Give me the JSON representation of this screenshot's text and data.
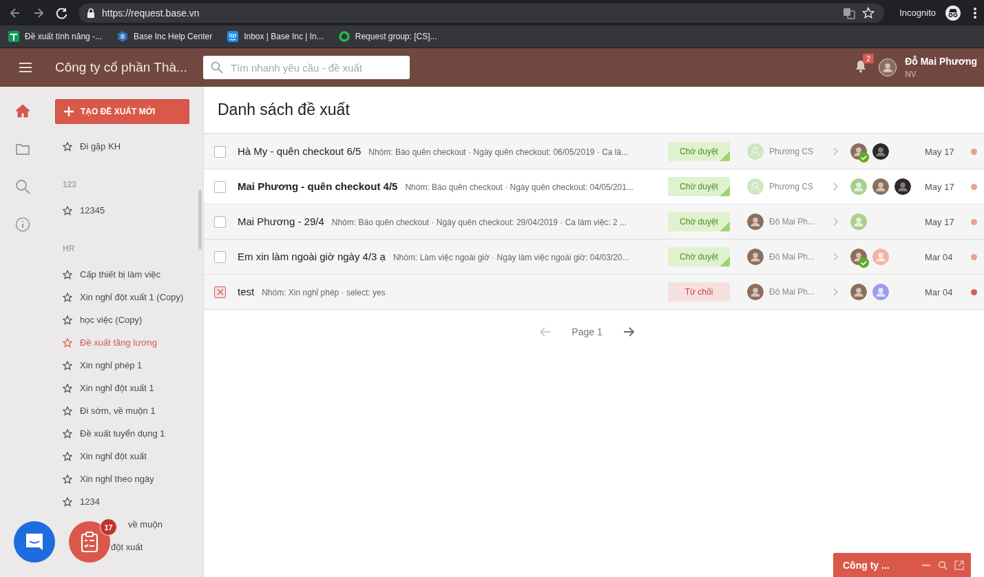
{
  "browser": {
    "url": "https://request.base.vn",
    "profile": "Incognito",
    "bookmarks": [
      {
        "label": "Đề xuất tính năng -..."
      },
      {
        "label": "Base Inc Help Center"
      },
      {
        "label": "Inbox | Base Inc | In..."
      },
      {
        "label": "Request group: [CS]..."
      }
    ]
  },
  "header": {
    "company": "Công ty cổ phần Thà...",
    "search": {
      "placeholder": "Tìm nhanh yêu cầu - đề xuất"
    },
    "notifications": "2",
    "user": {
      "name": "Đỗ Mai Phương",
      "role": "NV"
    }
  },
  "rail": [
    {
      "selected": true
    },
    {
      "selected": false
    },
    {
      "selected": false
    },
    {
      "selected": false
    }
  ],
  "sidebar": {
    "create_button": "TẠO ĐỀ XUẤT MỚI",
    "groups": [
      {
        "items": [
          {
            "label": "Đi gặp KH",
            "selected": false
          }
        ]
      },
      {
        "title": "123",
        "items": [
          {
            "label": "12345",
            "selected": false
          }
        ]
      },
      {
        "title": "HR",
        "items": [
          {
            "label": "Cấp thiết bị làm việc",
            "selected": false
          },
          {
            "label": "Xin nghỉ đột xuất 1 (Copy)",
            "selected": false
          },
          {
            "label": "học việc (Copy)",
            "selected": false
          },
          {
            "label": "Đề xuất tăng lương",
            "selected": true
          },
          {
            "label": "Xin nghỉ phép 1",
            "selected": false
          },
          {
            "label": "Xin nghỉ đột xuất 1",
            "selected": false
          },
          {
            "label": "Đi sớm, về muộn 1",
            "selected": false
          },
          {
            "label": "Đề xuất tuyển dụng 1",
            "selected": false
          },
          {
            "label": "Xin nghỉ đột xuất",
            "selected": false
          },
          {
            "label": "Xin nghỉ theo ngày",
            "selected": false
          },
          {
            "label": "1234",
            "selected": false
          },
          {
            "label": "về muộn",
            "selected": false,
            "covered": true
          },
          {
            "label": "đột xuất",
            "selected": false,
            "covered": true
          }
        ]
      }
    ]
  },
  "page": {
    "title": "Danh sách đề xuất",
    "rows": [
      {
        "title": "Hà My - quên checkout 6/5",
        "unread": false,
        "marked": false,
        "description": "Nhóm: Báo quên checkout · Ngày quên checkout: 06/05/2019 · Ca là...",
        "status": {
          "label": "Chờ duyệt",
          "kind": "pending"
        },
        "requester": {
          "name": "Phương CS",
          "kind": "placeholder"
        },
        "approvers": [
          {
            "kind": "photo",
            "approved": true
          },
          {
            "kind": "dark",
            "approved": false
          }
        ],
        "date": "May 17",
        "color": "#e8a194"
      },
      {
        "title": "Mai Phương - quên checkout 4/5",
        "unread": true,
        "marked": false,
        "description": "Nhóm: Báo quên checkout · Ngày quên checkout: 04/05/201...",
        "status": {
          "label": "Chờ duyệt",
          "kind": "pending"
        },
        "requester": {
          "name": "Phương CS",
          "kind": "placeholder"
        },
        "approvers": [
          {
            "kind": "green",
            "approved": false
          },
          {
            "kind": "photo",
            "approved": false
          },
          {
            "kind": "dark",
            "approved": false
          }
        ],
        "date": "May 17",
        "color": "#e8a194"
      },
      {
        "title": "Mai Phương - 29/4",
        "unread": false,
        "marked": false,
        "description": "Nhóm: Báo quên checkout · Ngày quên checkout: 29/04/2019 · Ca làm việc: 2 ...",
        "status": {
          "label": "Chờ duyệt",
          "kind": "pending"
        },
        "requester": {
          "name": "Đô Mai Ph...",
          "kind": "photo"
        },
        "approvers": [
          {
            "kind": "green",
            "approved": false
          }
        ],
        "date": "May 17",
        "color": "#e8a194"
      },
      {
        "title": "Em xin làm ngoài giờ ngày 4/3 ạ",
        "unread": false,
        "marked": false,
        "description": "Nhóm: Làm việc ngoài giờ · Ngày làm việc ngoài giờ: 04/03/20...",
        "status": {
          "label": "Chờ duyệt",
          "kind": "pending"
        },
        "requester": {
          "name": "Đô Mai Ph...",
          "kind": "photo"
        },
        "approvers": [
          {
            "kind": "photo",
            "approved": true
          },
          {
            "kind": "salmon",
            "approved": false
          }
        ],
        "date": "Mar 04",
        "color": "#e8a194"
      },
      {
        "title": "test",
        "unread": false,
        "marked": true,
        "description": "Nhóm: Xin nghỉ phép · select: yes",
        "status": {
          "label": "Từ chối",
          "kind": "rejected"
        },
        "requester": {
          "name": "Đô Mai Ph...",
          "kind": "photo"
        },
        "approvers": [
          {
            "kind": "photo",
            "approved": false
          },
          {
            "kind": "violet",
            "approved": false
          }
        ],
        "date": "Mar 04",
        "color": "#d0605c"
      }
    ],
    "pagination": {
      "label": "Page 1"
    }
  },
  "chat_badge": "17",
  "chat_window": {
    "title": "Công ty ..."
  }
}
